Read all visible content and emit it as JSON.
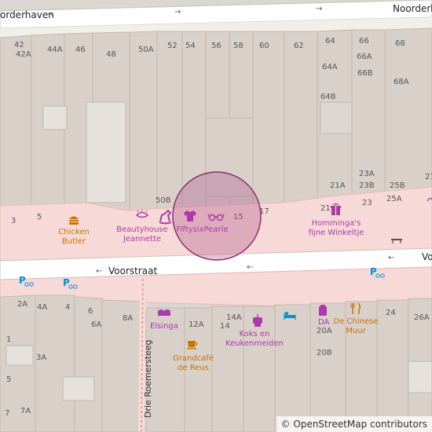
{
  "map": {
    "streets": {
      "noorderhaven_left": "orderhaven",
      "noorderhaven_right": "Noorderh",
      "voorstraat_left": "Voorstraat",
      "voorstraat_right": "Vo",
      "drie_roemersteeg": "Drie Roemersteeg"
    },
    "house_numbers": [
      "42",
      "42A",
      "44A",
      "46",
      "48",
      "50A",
      "52",
      "54",
      "56",
      "58",
      "60",
      "62",
      "64",
      "66",
      "68",
      "64A",
      "66A",
      "66B",
      "68A",
      "64B",
      "21A",
      "23A",
      "23B",
      "25B",
      "21",
      "23",
      "25A",
      "3",
      "5",
      "50B",
      "15",
      "17",
      "2A",
      "4A",
      "4",
      "6",
      "6A",
      "8A",
      "12A",
      "14A",
      "14",
      "24",
      "26A",
      "1",
      "3A",
      "5",
      "7",
      "7A",
      "20A",
      "20B",
      "DA",
      "27"
    ],
    "pois": {
      "chicken_butler": {
        "line1": "Chicken",
        "line2": "Butler",
        "icon": "fast-food-icon"
      },
      "beautyhouse": {
        "line1": "Beautyhouse",
        "line2": "Jeannette",
        "icon": "beauty-eye-icon"
      },
      "fiftysix": {
        "label": "Fiftysix",
        "icon": "clothes-shirt-icon"
      },
      "pearle": {
        "label": "Pearle",
        "icon": "optician-glasses-icon"
      },
      "hommingas": {
        "line1": "Homminga's",
        "line2": "fijne Winkeltje",
        "icon": "gift-icon"
      },
      "elsinga": {
        "label": "Elsinga",
        "icon": "bakery-icon"
      },
      "grandcafe": {
        "line1": "Grandcafé",
        "line2": "de Reus",
        "icon": "cafe-cup-icon"
      },
      "koks": {
        "line1": "Koks en",
        "line2": "Keukenmeiden",
        "icon": "kitchen-mixer-icon"
      },
      "da": {
        "line1": "DA",
        "icon": "pharmacy-bottle-icon"
      },
      "chinese_muur": {
        "line1": "De Chinese",
        "line2": "Muur",
        "icon": "restaurant-icon"
      },
      "toy_horse": {
        "icon": "toys-horse-icon"
      },
      "hotel": {
        "icon": "hotel-bed-icon"
      },
      "bench": {
        "icon": "bench-icon"
      }
    },
    "parking_icons": [
      "bicycle-parking-icon",
      "bicycle-parking-icon",
      "bicycle-parking-icon"
    ],
    "attribution": {
      "symbol": "©",
      "text": "OpenStreetMap contributors"
    },
    "colors": {
      "background": "#f2efe9",
      "building": "#d9d0c9",
      "pedestrian": "#f7d9d8",
      "road": "#ffffff",
      "marker_fill": "#b0568b",
      "shop": "#ac39ac",
      "food": "#c77400"
    }
  }
}
